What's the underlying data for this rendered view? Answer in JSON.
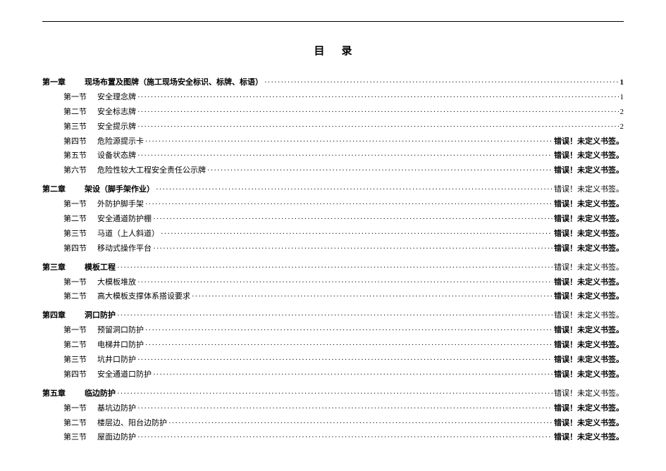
{
  "title": "目录",
  "error_text": "错误！未定义书签。",
  "chapters": [
    {
      "label": "第一章",
      "text": "现场布置及图牌（施工现场安全标识、标牌、标语）",
      "page": "1",
      "sections": [
        {
          "label": "第一节",
          "text": "安全理念牌",
          "page": "1"
        },
        {
          "label": "第二节",
          "text": "安全标志牌",
          "page": "2"
        },
        {
          "label": "第三节",
          "text": "安全提示牌",
          "page": "2"
        },
        {
          "label": "第四节",
          "text": "危险源提示卡",
          "page": "错误！未定义书签。"
        },
        {
          "label": "第五节",
          "text": "设备状态牌",
          "page": "错误！未定义书签。"
        },
        {
          "label": "第六节",
          "text": "危险性较大工程安全责任公示牌",
          "page": "错误！未定义书签。"
        }
      ]
    },
    {
      "label": "第二章",
      "text": "架设（脚手架作业）",
      "page": "错误！未定义书签。",
      "sections": [
        {
          "label": "第一节",
          "text": "外防护脚手架",
          "page": "错误！未定义书签。"
        },
        {
          "label": "第二节",
          "text": "安全通道防护棚",
          "page": "错误！未定义书签。"
        },
        {
          "label": "第三节",
          "text": "马道（上人斜道）",
          "page": "错误！未定义书签。"
        },
        {
          "label": "第四节",
          "text": "移动式操作平台",
          "page": "错误！未定义书签。"
        }
      ]
    },
    {
      "label": "第三章",
      "text": "模板工程",
      "page": "错误！未定义书签。",
      "sections": [
        {
          "label": "第一节",
          "text": "大模板堆放",
          "page": "错误！未定义书签。"
        },
        {
          "label": "第二节",
          "text": "高大模板支撑体系搭设要求",
          "page": "错误！未定义书签。"
        }
      ]
    },
    {
      "label": "第四章",
      "text": "洞口防护",
      "page": "错误！未定义书签。",
      "sections": [
        {
          "label": "第一节",
          "text": "预留洞口防护",
          "page": "错误！未定义书签。"
        },
        {
          "label": "第二节",
          "text": "电梯井口防护",
          "page": "错误！未定义书签。"
        },
        {
          "label": "第三节",
          "text": "坑井口防护",
          "page": "错误！未定义书签。"
        },
        {
          "label": "第四节",
          "text": "安全通道口防护",
          "page": "错误！未定义书签。"
        }
      ]
    },
    {
      "label": "第五章",
      "text": "临边防护",
      "page": "错误！未定义书签。",
      "sections": [
        {
          "label": "第一节",
          "text": "基坑边防护",
          "page": "错误！未定义书签。"
        },
        {
          "label": "第二节",
          "text": "楼层边、阳台边防护",
          "page": "错误！未定义书签。"
        },
        {
          "label": "第三节",
          "text": "屋面边防护",
          "page": "错误！未定义书签。"
        }
      ]
    }
  ]
}
